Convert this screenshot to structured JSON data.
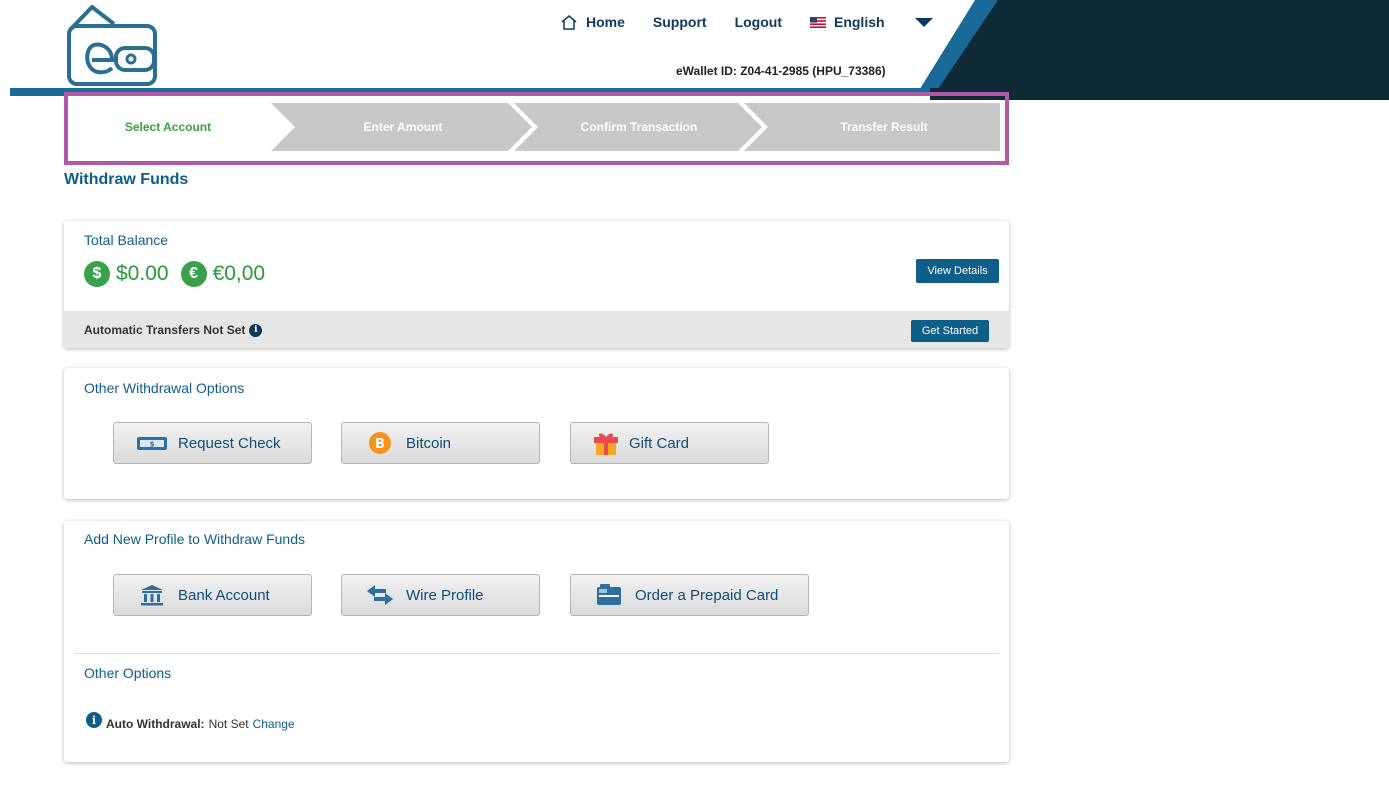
{
  "header": {
    "nav": {
      "home": "Home",
      "support": "Support",
      "logout": "Logout",
      "language": "English"
    },
    "wallet_id": "eWallet ID: Z04-41-2985 (HPU_73386)"
  },
  "stepper": {
    "steps": [
      {
        "label": "Select Account",
        "active": true
      },
      {
        "label": "Enter Amount",
        "active": false
      },
      {
        "label": "Confirm Transaction",
        "active": false
      },
      {
        "label": "Transfer Result",
        "active": false
      }
    ]
  },
  "page_title": "Withdraw Funds",
  "balance": {
    "title": "Total Balance",
    "usd_symbol": "$",
    "usd": "$0.00",
    "eur_symbol": "€",
    "eur": "€0,00",
    "view_details": "View Details",
    "auto_transfers": "Automatic Transfers Not Set",
    "get_started": "Get Started"
  },
  "other_withdrawal": {
    "title": "Other Withdrawal Options",
    "buttons": [
      "Request Check",
      "Bitcoin",
      "Gift Card"
    ]
  },
  "add_profile": {
    "title": "Add New Profile to Withdraw Funds",
    "buttons": [
      "Bank Account",
      "Wire Profile",
      "Order a Prepaid Card"
    ],
    "other_options_title": "Other Options",
    "auto_withdrawal_label": "Auto Withdrawal:",
    "auto_withdrawal_value": "Not Set",
    "change_link": "Change"
  },
  "colors": {
    "brand_blue": "#0d5f8a",
    "dark_navy": "#0d2a36",
    "success_green": "#2a9a3a",
    "highlight_frame": "#b05aa8",
    "step_inactive": "#c8c8c8"
  }
}
